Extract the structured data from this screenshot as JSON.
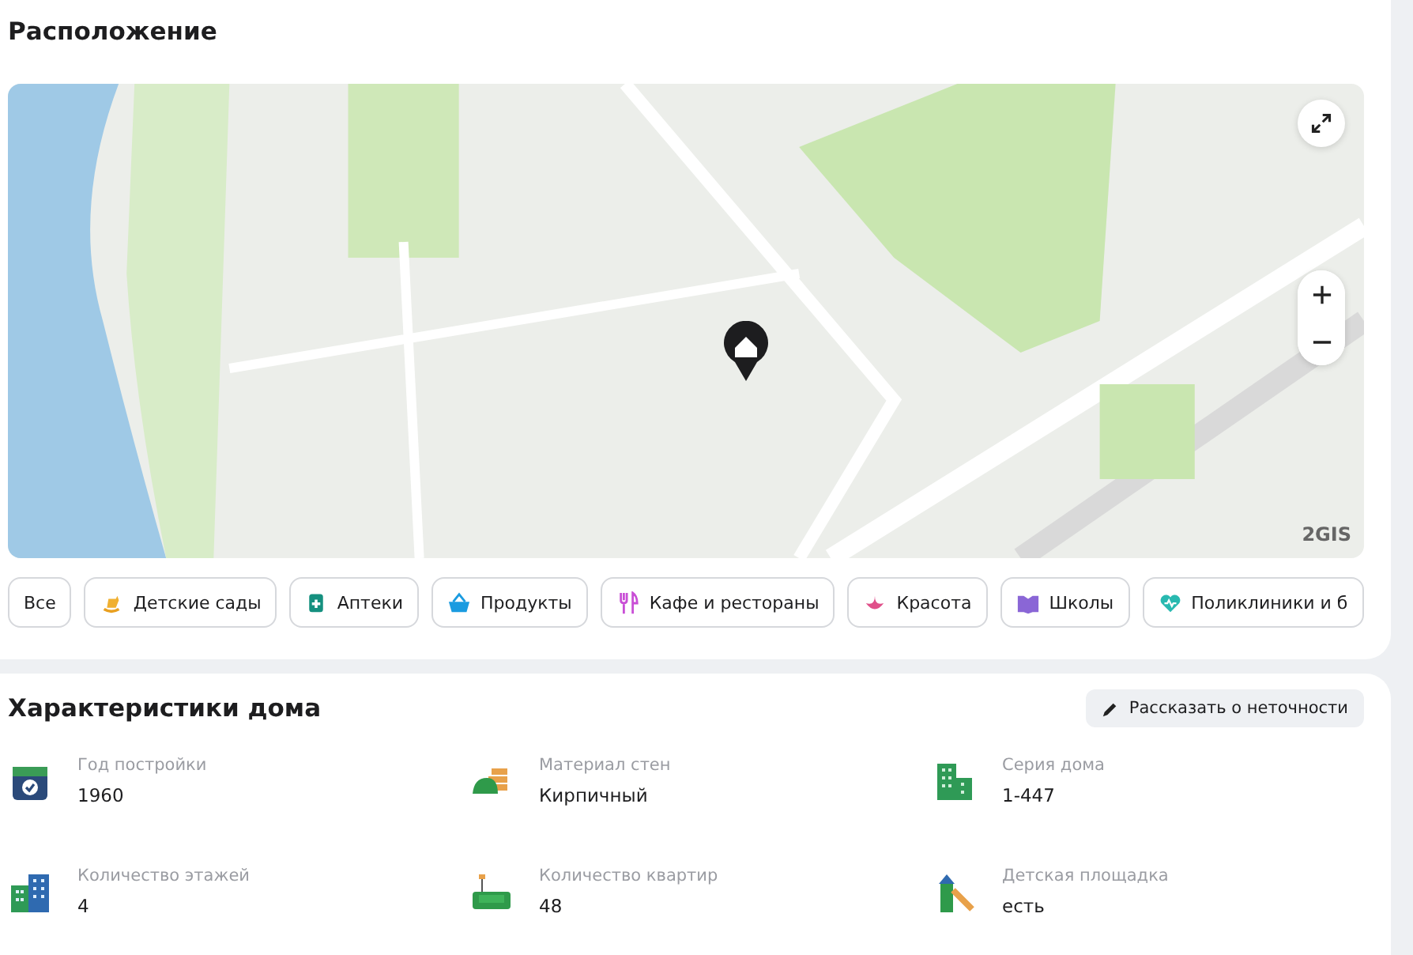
{
  "location": {
    "title": "Расположение",
    "map": {
      "attribution": "2GIS"
    },
    "categories": [
      {
        "label": "Все",
        "kind": "all",
        "selected": false
      },
      {
        "label": "Детские сады",
        "kind": "kindergarten",
        "selected": false
      },
      {
        "label": "Аптеки",
        "kind": "pharmacy",
        "selected": false
      },
      {
        "label": "Продукты",
        "kind": "groceries",
        "selected": false
      },
      {
        "label": "Кафе и рестораны",
        "kind": "cafe",
        "selected": false
      },
      {
        "label": "Красота",
        "kind": "beauty",
        "selected": false
      },
      {
        "label": "Школы",
        "kind": "school",
        "selected": false
      },
      {
        "label": "Поликлиники и б",
        "kind": "clinic",
        "selected": false
      }
    ]
  },
  "house": {
    "title": "Характеристики дома",
    "report_button": "Рассказать о неточности",
    "specs": [
      {
        "label": "Год постройки",
        "value": "1960",
        "kind": "year"
      },
      {
        "label": "Материал стен",
        "value": "Кирпичный",
        "kind": "material"
      },
      {
        "label": "Серия дома",
        "value": "1-447",
        "kind": "series"
      },
      {
        "label": "Количество этажей",
        "value": "4",
        "kind": "floors"
      },
      {
        "label": "Количество квартир",
        "value": "48",
        "kind": "flats"
      },
      {
        "label": "Детская площадка",
        "value": "есть",
        "kind": "playground"
      }
    ]
  }
}
